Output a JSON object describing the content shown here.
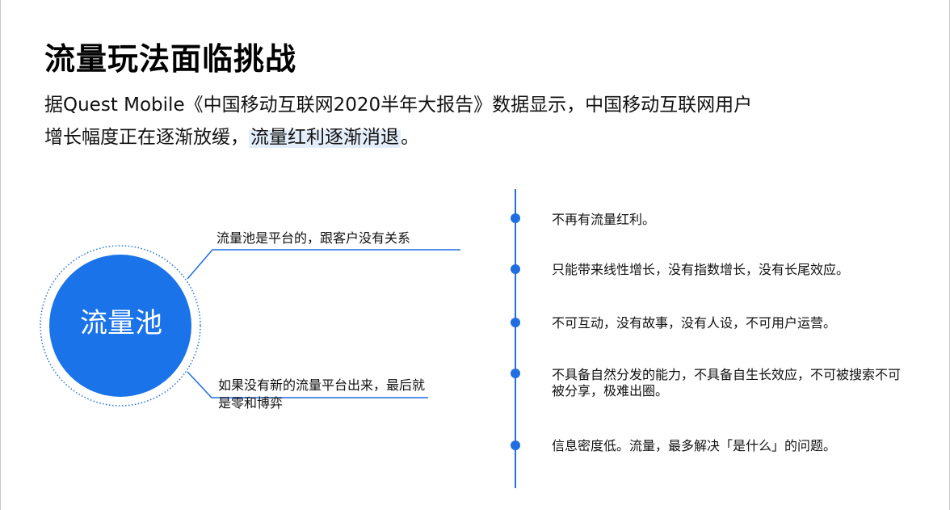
{
  "title": "流量玩法面临挑战",
  "intro": {
    "line1": "据Quest Mobile《中国移动互联网2020半年大报告》数据显示，中国移动互联网用户",
    "line2_prefix": "增长幅度正在逐渐放缓，",
    "line2_highlight": "流量红利逐渐消退",
    "line2_suffix": "。"
  },
  "diagram": {
    "circle_label": "流量池",
    "callout_top": "流量池是平台的，跟客户没有关系",
    "callout_bottom": "如果没有新的流量平台出来，最后就是零和博弈"
  },
  "timeline": {
    "items": [
      {
        "text": "不再有流量红利。"
      },
      {
        "text": "只能带来线性增长，没有指数增长，没有长尾效应。"
      },
      {
        "text": "不可互动，没有故事，没有人设，不可用户运营。"
      },
      {
        "text": "不具备自然分发的能力，不具备自生长效应，不可被搜索不可被分享，极难出圈。"
      },
      {
        "text": "信息密度低。流量，最多解决「是什么」的问题。"
      }
    ]
  },
  "colors": {
    "accent": "#1f6fe0",
    "circle_fill": "#1a73e8",
    "highlight": "#e4eefb"
  }
}
